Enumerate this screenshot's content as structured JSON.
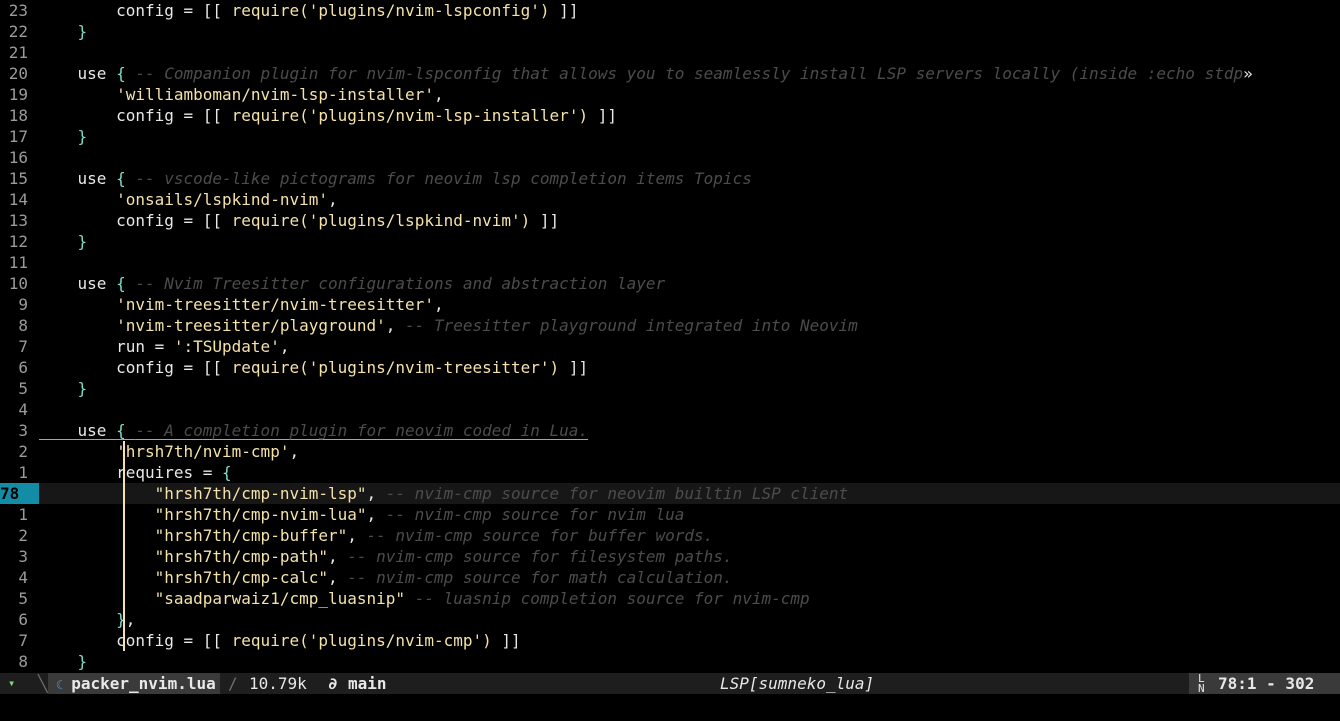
{
  "editor": {
    "lines": [
      {
        "num": "23",
        "tokens": [
          [
            "plain",
            "        config = [[ "
          ],
          [
            "fn",
            "require"
          ],
          [
            "str",
            "('plugins/nvim-lspconfig')"
          ],
          [
            "plain",
            " ]]"
          ]
        ]
      },
      {
        "num": "22",
        "tokens": [
          [
            "plain",
            "    "
          ],
          [
            "punct",
            "}"
          ]
        ]
      },
      {
        "num": "21",
        "tokens": []
      },
      {
        "num": "20",
        "tokens": [
          [
            "kw",
            "    use "
          ],
          [
            "punct",
            "{ "
          ],
          [
            "comment",
            "-- Companion plugin for nvim-lspconfig that allows you to seamlessly install LSP servers locally (inside :echo stdp"
          ],
          [
            "overflow",
            "»"
          ]
        ]
      },
      {
        "num": "19",
        "tokens": [
          [
            "str",
            "        'williamboman/nvim-lsp-installer'"
          ],
          [
            "plain",
            ","
          ]
        ]
      },
      {
        "num": "18",
        "tokens": [
          [
            "plain",
            "        config = [[ "
          ],
          [
            "fn",
            "require"
          ],
          [
            "str",
            "('plugins/nvim-lsp-installer')"
          ],
          [
            "plain",
            " ]]"
          ]
        ]
      },
      {
        "num": "17",
        "tokens": [
          [
            "plain",
            "    "
          ],
          [
            "punct",
            "}"
          ]
        ]
      },
      {
        "num": "16",
        "tokens": []
      },
      {
        "num": "15",
        "tokens": [
          [
            "kw",
            "    use "
          ],
          [
            "punct",
            "{ "
          ],
          [
            "comment",
            "-- vscode-like pictograms for neovim lsp completion items Topics"
          ]
        ]
      },
      {
        "num": "14",
        "tokens": [
          [
            "str",
            "        'onsails/lspkind-nvim'"
          ],
          [
            "plain",
            ","
          ]
        ]
      },
      {
        "num": "13",
        "tokens": [
          [
            "plain",
            "        config = [[ "
          ],
          [
            "fn",
            "require"
          ],
          [
            "str",
            "('plugins/lspkind-nvim')"
          ],
          [
            "plain",
            " ]]"
          ]
        ]
      },
      {
        "num": "12",
        "tokens": [
          [
            "plain",
            "    "
          ],
          [
            "punct",
            "}"
          ]
        ]
      },
      {
        "num": "11",
        "tokens": []
      },
      {
        "num": "10",
        "tokens": [
          [
            "kw",
            "    use "
          ],
          [
            "punct",
            "{ "
          ],
          [
            "comment",
            "-- Nvim Treesitter configurations and abstraction layer"
          ]
        ]
      },
      {
        "num": "9",
        "tokens": [
          [
            "str",
            "        'nvim-treesitter/nvim-treesitter'"
          ],
          [
            "plain",
            ","
          ]
        ]
      },
      {
        "num": "8",
        "tokens": [
          [
            "str",
            "        'nvim-treesitter/playground'"
          ],
          [
            "plain",
            ", "
          ],
          [
            "comment",
            "-- Treesitter playground integrated into Neovim"
          ]
        ]
      },
      {
        "num": "7",
        "tokens": [
          [
            "plain",
            "        run = "
          ],
          [
            "str",
            "':TSUpdate'"
          ],
          [
            "plain",
            ","
          ]
        ]
      },
      {
        "num": "6",
        "tokens": [
          [
            "plain",
            "        config = [[ "
          ],
          [
            "fn",
            "require"
          ],
          [
            "str",
            "('plugins/nvim-treesitter')"
          ],
          [
            "plain",
            " ]]"
          ]
        ]
      },
      {
        "num": "5",
        "tokens": [
          [
            "plain",
            "    "
          ],
          [
            "punct",
            "}"
          ]
        ]
      },
      {
        "num": "4",
        "tokens": []
      },
      {
        "num": "3",
        "underline": true,
        "tokens": [
          [
            "kw",
            "    use "
          ],
          [
            "punct",
            "{ "
          ],
          [
            "comment",
            "-- A completion plugin for neovim coded in Lua."
          ]
        ]
      },
      {
        "num": "2",
        "tokens": [
          [
            "str",
            "        'hrsh7th/nvim-cmp'"
          ],
          [
            "plain",
            ","
          ]
        ]
      },
      {
        "num": "1",
        "tokens": [
          [
            "plain",
            "        requires = "
          ],
          [
            "punct",
            "{"
          ]
        ]
      },
      {
        "num": "78",
        "cursor": true,
        "tokens": [
          [
            "str",
            "            \"hrsh7th/cmp-nvim-lsp\""
          ],
          [
            "plain",
            ", "
          ],
          [
            "comment",
            "-- nvim-cmp source for neovim builtin LSP client"
          ]
        ]
      },
      {
        "num": "1",
        "tokens": [
          [
            "str",
            "            \"hrsh7th/cmp-nvim-lua\""
          ],
          [
            "plain",
            ", "
          ],
          [
            "comment",
            "-- nvim-cmp source for nvim lua"
          ]
        ]
      },
      {
        "num": "2",
        "tokens": [
          [
            "str",
            "            \"hrsh7th/cmp-buffer\""
          ],
          [
            "plain",
            ", "
          ],
          [
            "comment",
            "-- nvim-cmp source for buffer words."
          ]
        ]
      },
      {
        "num": "3",
        "tokens": [
          [
            "str",
            "            \"hrsh7th/cmp-path\""
          ],
          [
            "plain",
            ", "
          ],
          [
            "comment",
            "-- nvim-cmp source for filesystem paths."
          ]
        ]
      },
      {
        "num": "4",
        "tokens": [
          [
            "str",
            "            \"hrsh7th/cmp-calc\""
          ],
          [
            "plain",
            ", "
          ],
          [
            "comment",
            "-- nvim-cmp source for math calculation."
          ]
        ]
      },
      {
        "num": "5",
        "tokens": [
          [
            "str",
            "            \"saadparwaiz1/cmp_luasnip\""
          ],
          [
            "plain",
            " "
          ],
          [
            "comment",
            "-- luasnip completion source for nvim-cmp"
          ]
        ]
      },
      {
        "num": "6",
        "tokens": [
          [
            "plain",
            "        "
          ],
          [
            "punct",
            "}"
          ],
          [
            "plain",
            ","
          ]
        ]
      },
      {
        "num": "7",
        "tokens": [
          [
            "plain",
            "        config = [[ "
          ],
          [
            "fn",
            "require"
          ],
          [
            "str",
            "('plugins/nvim-cmp')"
          ],
          [
            "plain",
            " ]]"
          ]
        ]
      },
      {
        "num": "8",
        "tokens": [
          [
            "plain",
            "    "
          ],
          [
            "punct",
            "}"
          ]
        ]
      }
    ]
  },
  "statusline": {
    "mode_icon": "▾",
    "file_icon": "☾",
    "filename": "packer_nvim.lua",
    "slash": "/",
    "size": "10.79k",
    "branch_icon": "∂",
    "branch": "main",
    "lsp": "LSP[sumneko_lua]",
    "ln_icon_top": "L",
    "ln_icon_bottom": "N",
    "position": "78:1 - 302"
  },
  "colors": {
    "background": "#000000",
    "cursor_line": "#171717",
    "cursor_line_number_bg": "#138da6",
    "string": "#f4e2a8",
    "bracket": "#7fdcc8",
    "comment": "#4c4c4c",
    "statusline_bg": "#1e1e1e"
  }
}
